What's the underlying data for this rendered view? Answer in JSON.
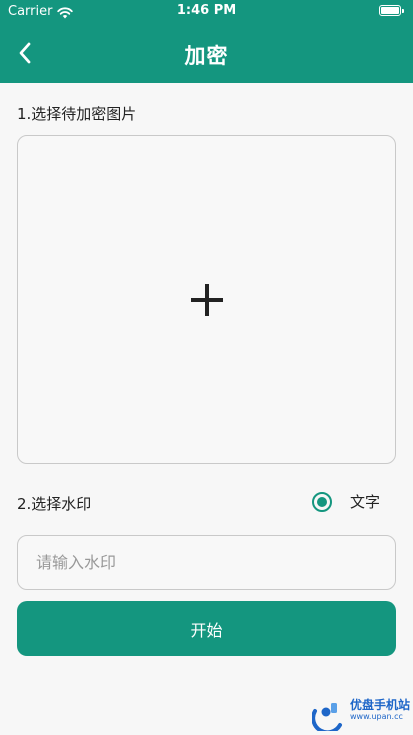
{
  "status_bar": {
    "carrier": "Carrier",
    "time": "1:46 PM"
  },
  "nav": {
    "title": "加密",
    "back_icon": "chevron-left-icon"
  },
  "section1": {
    "label": "1.选择待加密图片",
    "add_icon": "plus-icon"
  },
  "section2": {
    "label": "2.选择水印",
    "radio_option": "文字",
    "radio_selected": true
  },
  "input": {
    "placeholder": "请输入水印",
    "value": ""
  },
  "start_button": {
    "label": "开始"
  },
  "watermark_logo": {
    "text_cn": "优盘手机站",
    "text_en": "www.upan.cc"
  },
  "colors": {
    "primary": "#14967f",
    "background": "#f7f7f7",
    "border": "#c9c9c9"
  }
}
